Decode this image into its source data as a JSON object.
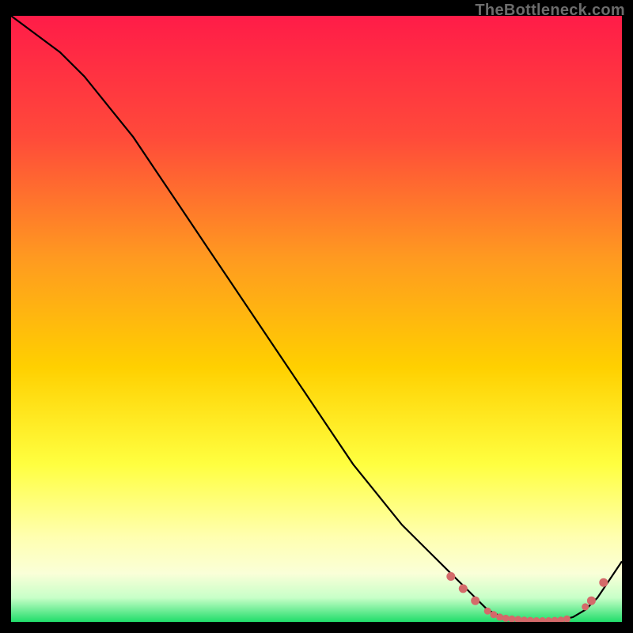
{
  "watermark": "TheBottleneck.com",
  "colors": {
    "bg": "#000000",
    "gradient_top": "#ff1c48",
    "gradient_mid1": "#ff7a2a",
    "gradient_mid2": "#ffd000",
    "gradient_mid3": "#ffff40",
    "gradient_light": "#ffffb0",
    "gradient_green": "#20dd6a",
    "curve": "#000000",
    "dots": "#d46a6a"
  },
  "chart_data": {
    "type": "line",
    "title": "",
    "xlabel": "",
    "ylabel": "",
    "xlim": [
      0,
      100
    ],
    "ylim": [
      0,
      100
    ],
    "annotations": [
      "TheBottleneck.com"
    ],
    "series": [
      {
        "name": "bottleneck-curve",
        "x": [
          0,
          4,
          8,
          12,
          16,
          20,
          24,
          28,
          32,
          36,
          40,
          44,
          48,
          52,
          56,
          60,
          64,
          68,
          72,
          74,
          76,
          78,
          80,
          82,
          84,
          86,
          88,
          90,
          92,
          94,
          96,
          98,
          100
        ],
        "y": [
          100,
          97,
          94,
          90,
          85,
          80,
          74,
          68,
          62,
          56,
          50,
          44,
          38,
          32,
          26,
          21,
          16,
          12,
          8,
          6,
          4,
          2,
          1,
          0.5,
          0.3,
          0.2,
          0.2,
          0.3,
          0.8,
          2,
          4,
          7,
          10
        ]
      }
    ],
    "highlight_points": {
      "name": "optimal-range-dots",
      "x": [
        72,
        74,
        76,
        78,
        79,
        80,
        81,
        82,
        83,
        84,
        85,
        86,
        87,
        88,
        89,
        90,
        91,
        94,
        95,
        97
      ],
      "y": [
        7.5,
        5.5,
        3.5,
        1.8,
        1.2,
        0.8,
        0.6,
        0.5,
        0.4,
        0.3,
        0.25,
        0.2,
        0.2,
        0.2,
        0.25,
        0.3,
        0.5,
        2.5,
        3.5,
        6.5
      ]
    }
  }
}
